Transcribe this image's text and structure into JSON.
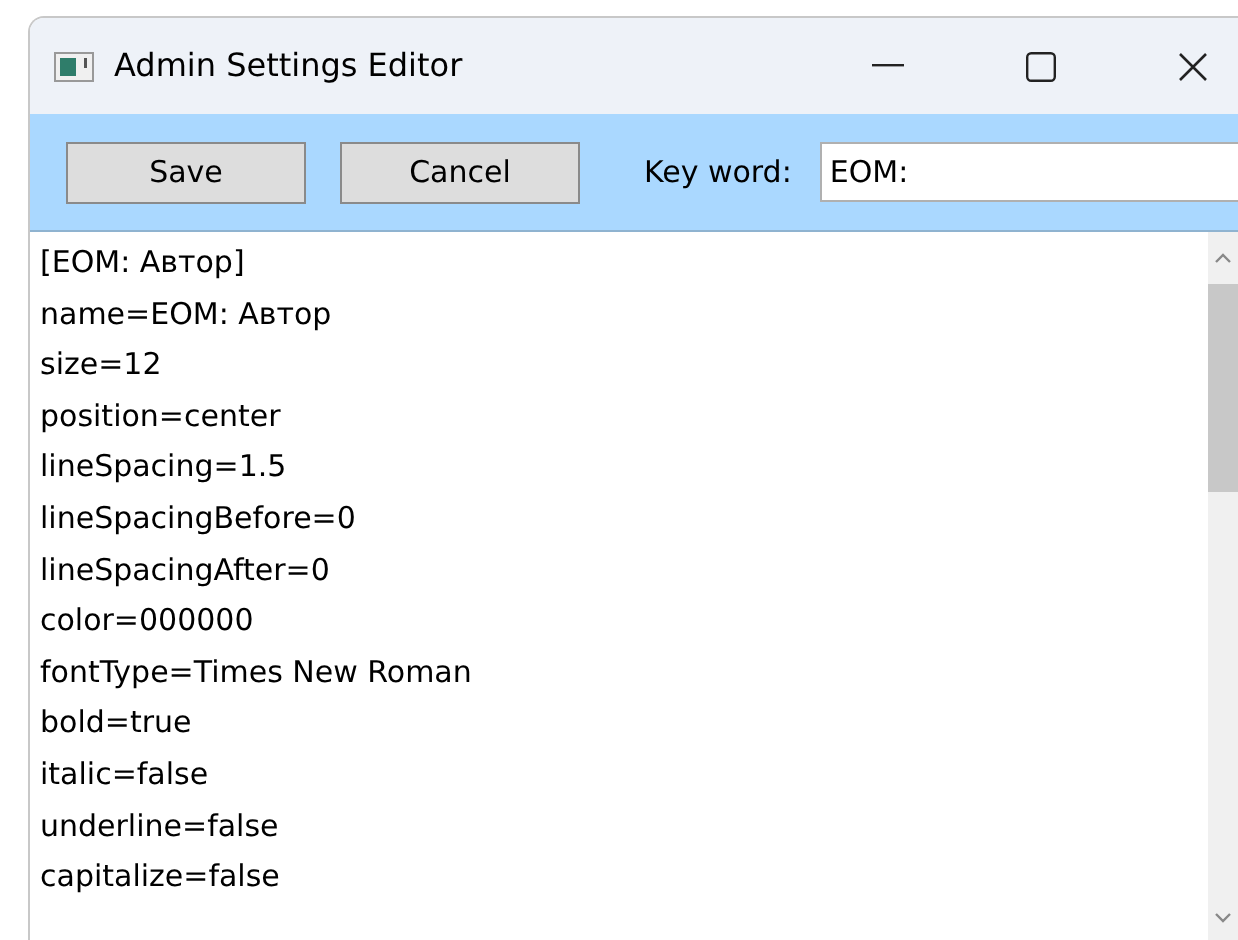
{
  "window": {
    "title": "Admin Settings Editor"
  },
  "toolbar": {
    "buttons": [
      "Save",
      "Cancel"
    ],
    "keyword_label": "Key word:",
    "keyword_value": "EOM:"
  },
  "editor": {
    "lines": [
      "[EOM: Автор]",
      "name=EOM: Автор",
      "size=12",
      "position=center",
      "lineSpacing=1.5",
      "lineSpacingBefore=0",
      "lineSpacingAfter=0",
      "color=000000",
      "fontType=Times New Roman",
      "bold=true",
      "italic=false",
      "underline=false",
      "capitalize=false"
    ]
  }
}
